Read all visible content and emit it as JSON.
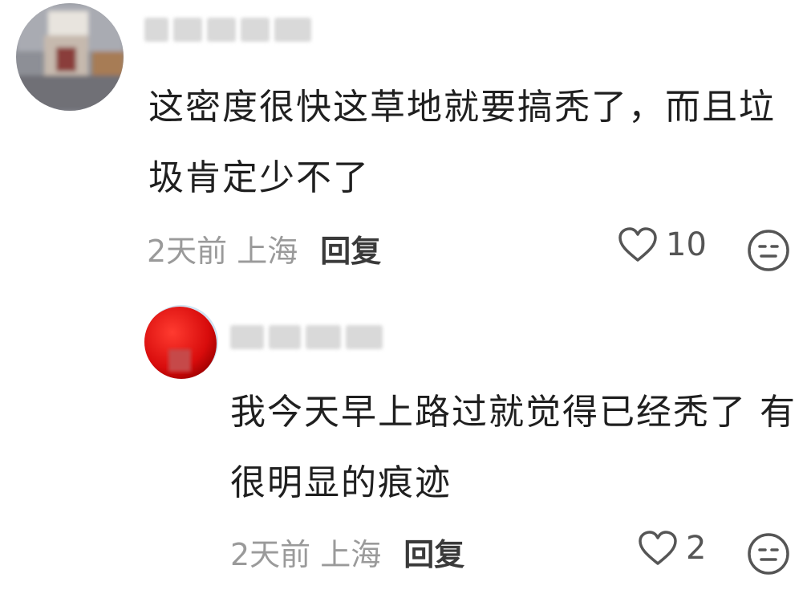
{
  "comments": [
    {
      "text": "这密度很快这草地就要搞秃了，而且垃圾肯定少不了",
      "time": "2天前",
      "location": "上海",
      "reply_label": "回复",
      "likes": "10",
      "avatar_icon": "blurred-person-avatar"
    },
    {
      "text": "我今天早上路过就觉得已经秃了 有很明显的痕迹",
      "time": "2天前",
      "location": "上海",
      "reply_label": "回复",
      "likes": "2",
      "avatar_icon": "red-ball-avatar"
    }
  ],
  "icons": {
    "like": "heart-outline-icon",
    "dislike": "meh-face-icon"
  },
  "colors": {
    "text": "#1f1f1f",
    "meta": "#9a9a9a",
    "reply": "#3a3a3a",
    "icon": "#555555"
  }
}
